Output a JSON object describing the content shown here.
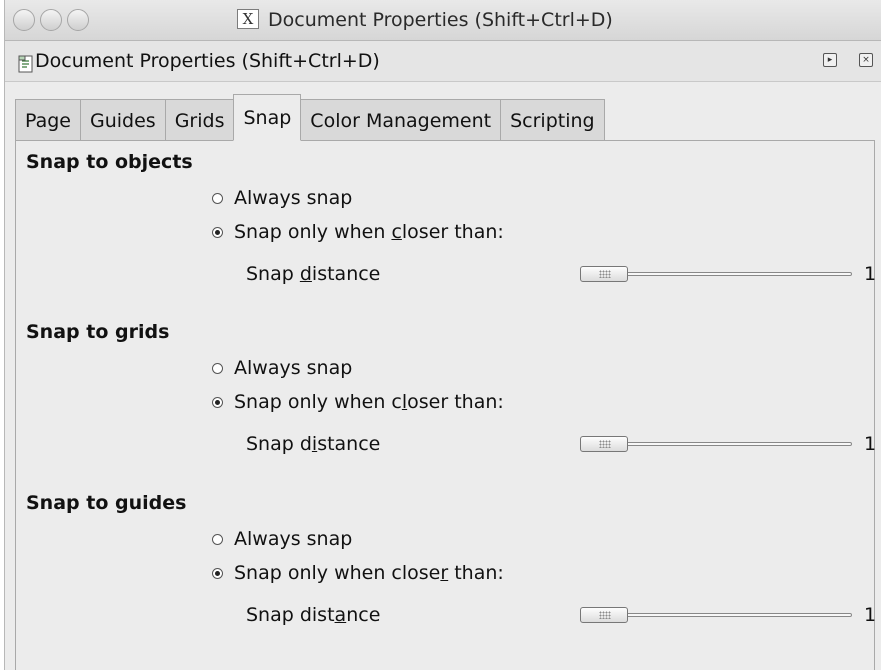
{
  "window": {
    "title": "Document Properties (Shift+Ctrl+D)"
  },
  "panel": {
    "title": "Document Properties (Shift+Ctrl+D)"
  },
  "tabs": [
    {
      "label": "Page",
      "active": false
    },
    {
      "label": "Guides",
      "active": false
    },
    {
      "label": "Grids",
      "active": false
    },
    {
      "label": "Snap",
      "active": true
    },
    {
      "label": "Color Management",
      "active": false
    },
    {
      "label": "Scripting",
      "active": false
    }
  ],
  "sections": [
    {
      "title": "Snap to objects",
      "always_label": "Always snap",
      "closer_label": {
        "before": "Snap only when ",
        "key": "c",
        "after": "loser than:"
      },
      "distance_label": {
        "before": "Snap ",
        "key": "d",
        "after": "istance"
      },
      "selected": "closer",
      "value": "1"
    },
    {
      "title": "Snap to grids",
      "always_label": "Always snap",
      "closer_label": {
        "before": "Snap only when c",
        "key": "l",
        "after": "oser than:"
      },
      "distance_label": {
        "before": "Snap d",
        "key": "i",
        "after": "stance"
      },
      "selected": "closer",
      "value": "1"
    },
    {
      "title": "Snap to guides",
      "always_label": "Always snap",
      "closer_label": {
        "before": "Snap only when close",
        "key": "r",
        "after": " than:"
      },
      "distance_label": {
        "before": "Snap dist",
        "key": "a",
        "after": "nce"
      },
      "selected": "closer",
      "value": "1"
    }
  ]
}
